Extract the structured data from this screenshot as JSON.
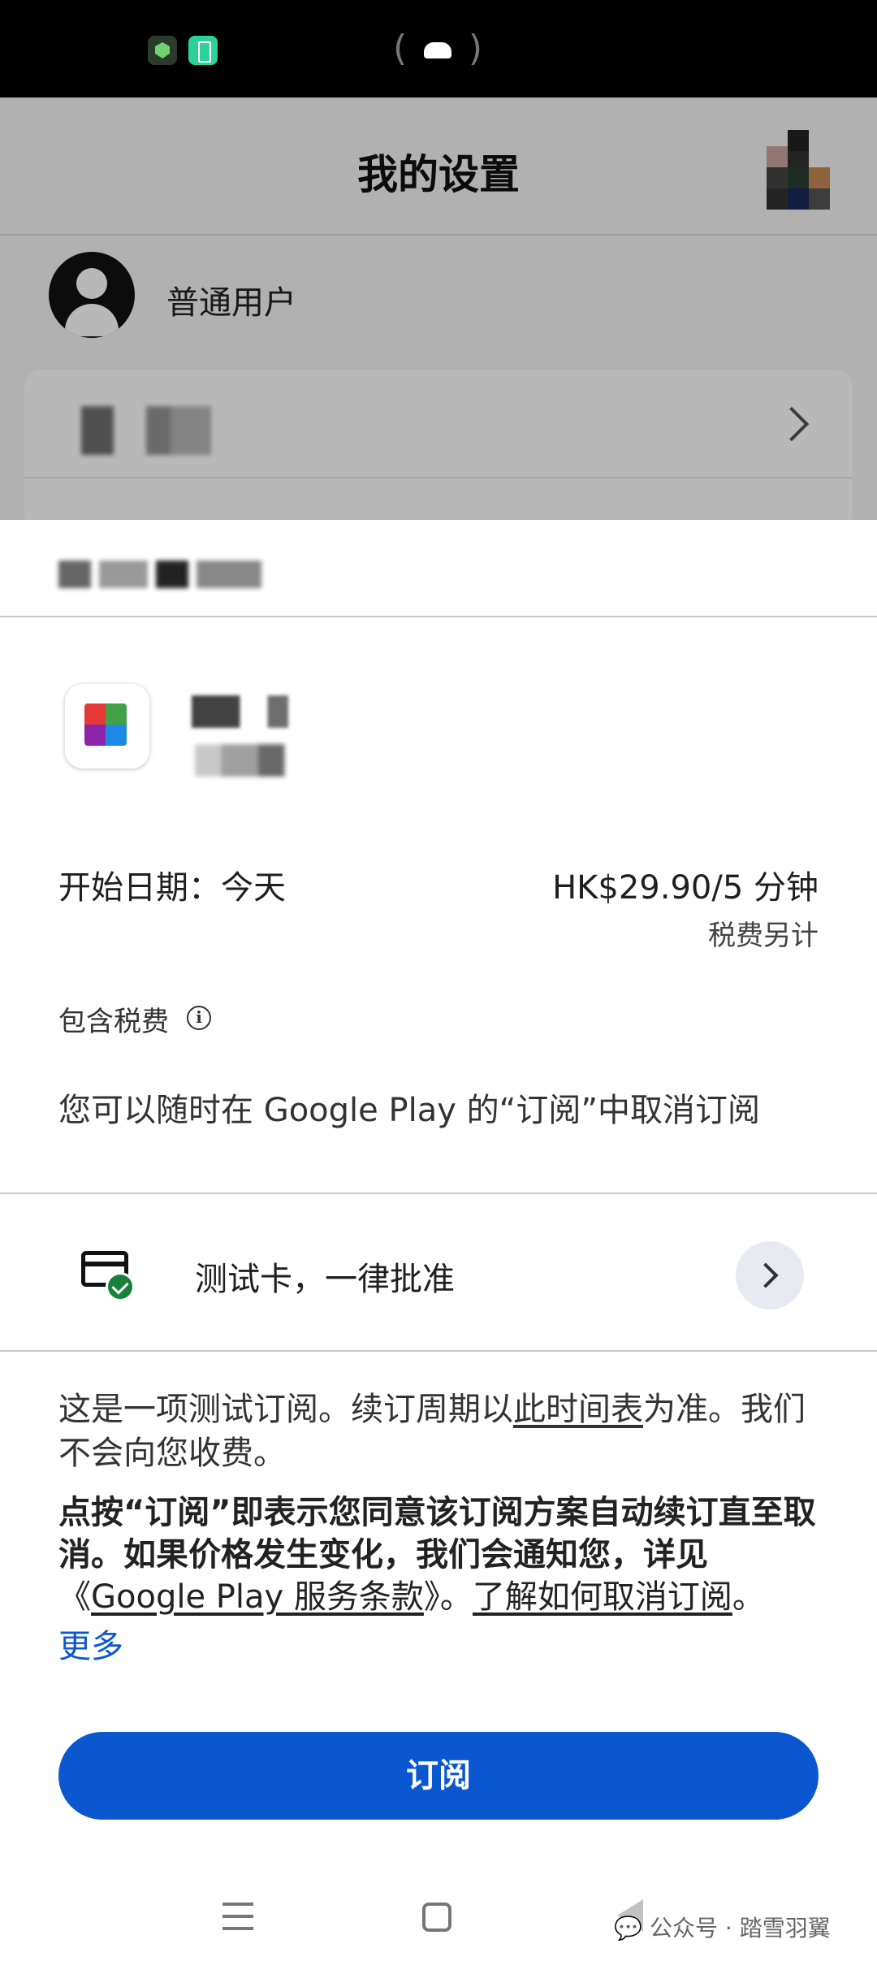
{
  "status_bar": {
    "icons": [
      "shield-icon",
      "battery-saver-icon",
      "cloud-hotspot-icon"
    ]
  },
  "background_page": {
    "title": "我的设置",
    "user_name": "普通用户"
  },
  "sheet": {
    "start_date": "开始日期：今天",
    "price": "HK$29.90/5 分钟",
    "tax_extra": "税费另计",
    "tax_included": "包含税费",
    "cancel_note": "您可以随时在 Google Play 的“订阅”中取消订阅",
    "payment_method": "测试卡，一律批准",
    "terms": {
      "line1_a": "这是一项测试订阅。续订周期以",
      "line1_link": "此时间表",
      "line1_b": "为准。我们不会向您收费。",
      "bold": "点按“订阅”即表示您同意该订阅方案自动续订直至取消。如果价格发生变化，我们会通知您，详见",
      "tos_open": "《",
      "tos_link": "Google Play 服务条款",
      "tos_close": "》。",
      "cancel_link": "了解如何取消订阅",
      "period": "。",
      "more": "更多"
    },
    "subscribe_label": "订阅"
  },
  "navbar": {
    "watermark": "公众号 · 踏雪羽翼"
  },
  "colors": {
    "primary": "#0b57d0",
    "check": "#188038"
  }
}
